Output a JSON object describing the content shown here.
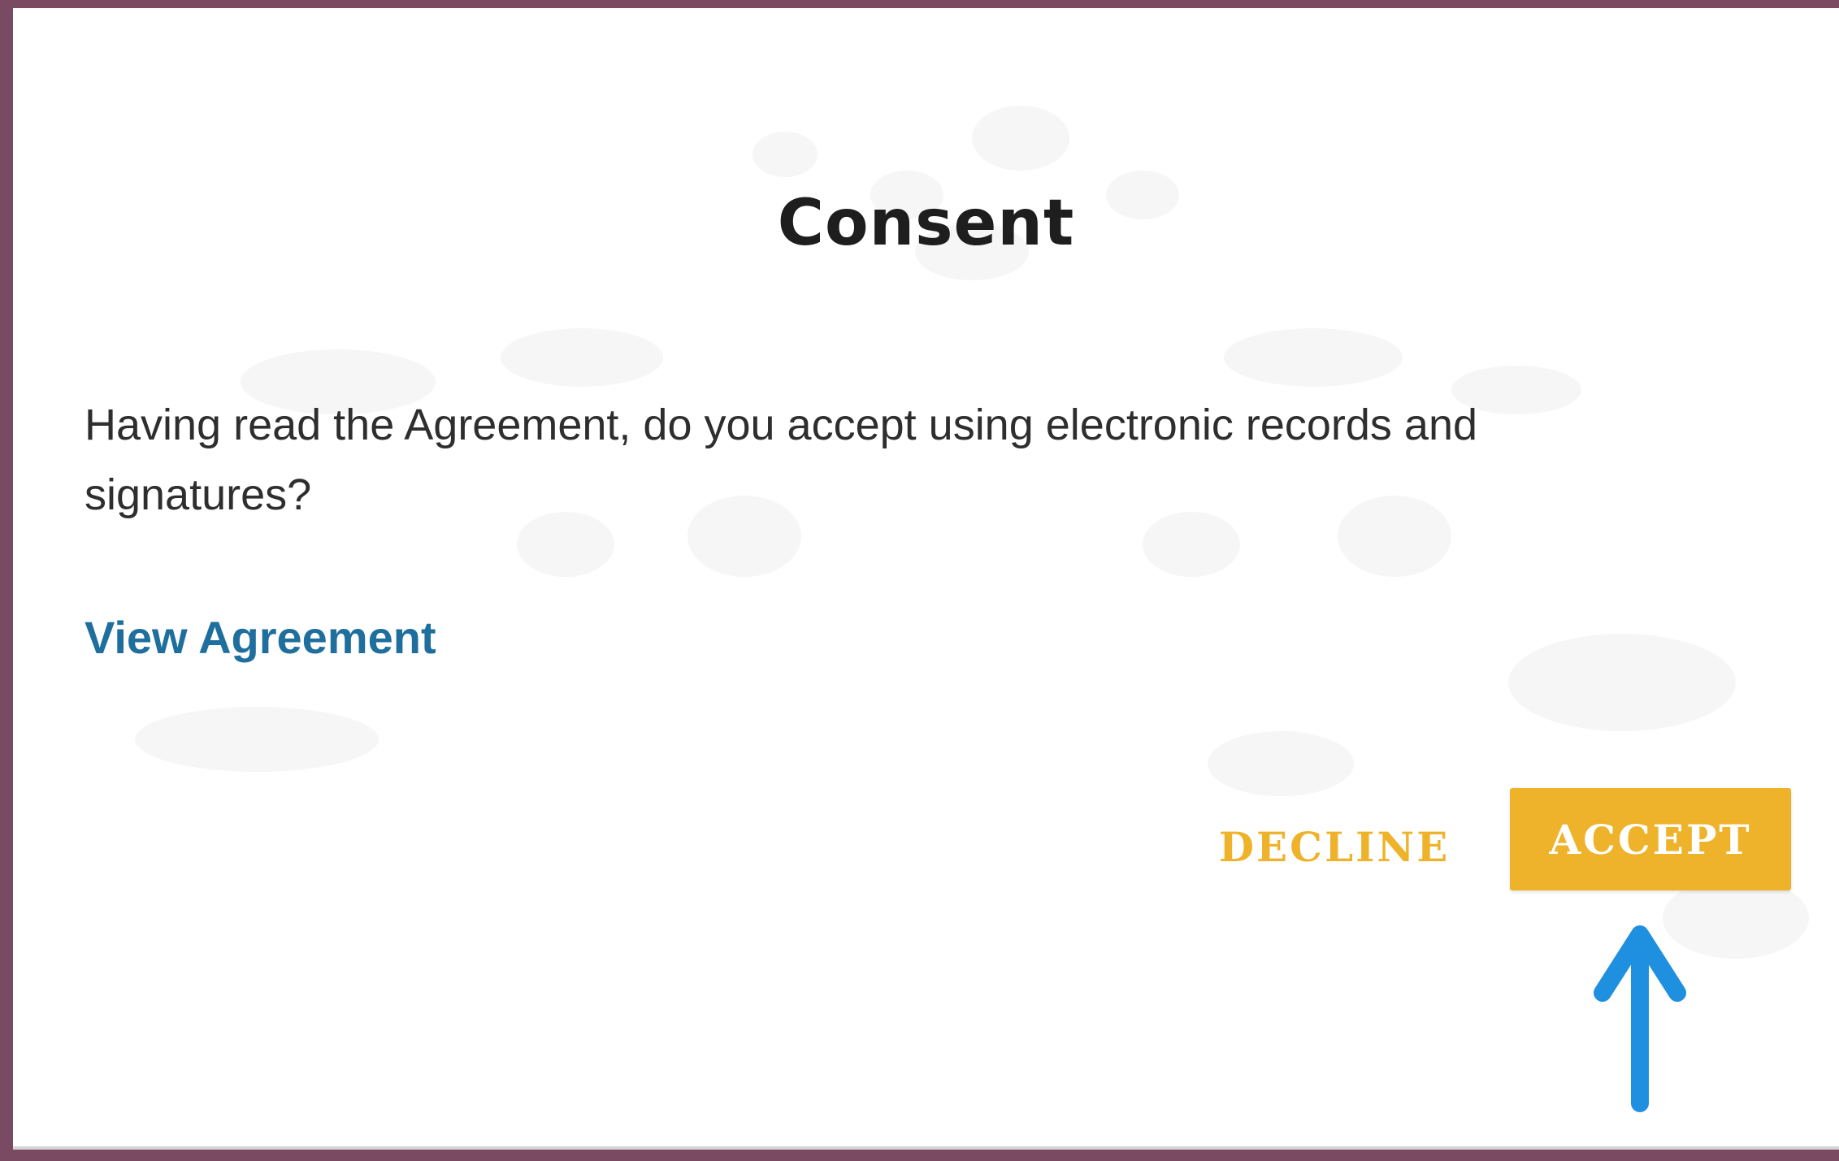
{
  "dialog": {
    "title": "Consent",
    "message": "Having read the Agreement, do you accept using electronic records and signatures?",
    "link_label": "View Agreement",
    "decline_label": "DECLINE",
    "accept_label": "ACCEPT"
  },
  "colors": {
    "backdrop": "#7a4a62",
    "dialog_background": "#ffffff",
    "link": "#1f6f9e",
    "accent": "#eeb32b",
    "annotation_arrow": "#1f8fe0"
  },
  "icons": {
    "annotation": "arrow-up-icon"
  }
}
